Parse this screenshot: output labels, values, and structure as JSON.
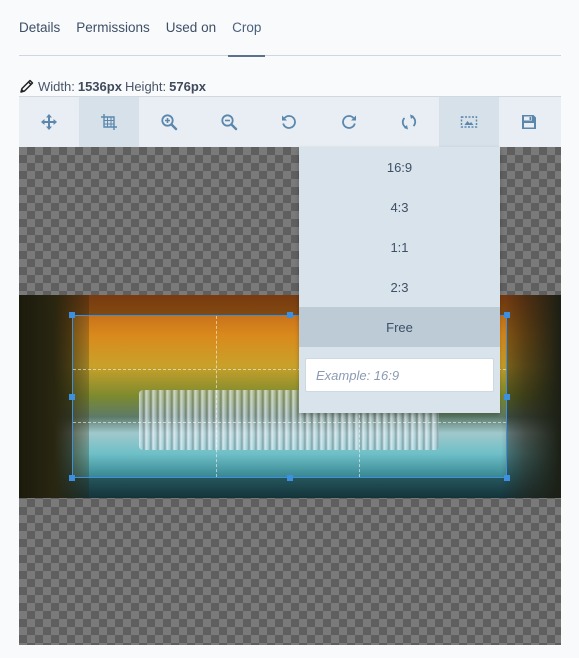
{
  "tabs": [
    {
      "label": "Details",
      "active": false
    },
    {
      "label": "Permissions",
      "active": false
    },
    {
      "label": "Used on",
      "active": false
    },
    {
      "label": "Crop",
      "active": true
    }
  ],
  "dimensions": {
    "width_label": "Width:",
    "width_value": "1536px",
    "height_label": "Height:",
    "height_value": "576px",
    "icon": "pencil-icon"
  },
  "toolbar": {
    "tools": [
      {
        "name": "move",
        "icon": "move-arrows-icon",
        "active": false
      },
      {
        "name": "crop",
        "icon": "crop-icon",
        "active": true
      },
      {
        "name": "zoom-in",
        "icon": "zoom-in-icon",
        "active": false
      },
      {
        "name": "zoom-out",
        "icon": "zoom-out-icon",
        "active": false
      },
      {
        "name": "rotate-left",
        "icon": "rotate-left-icon",
        "active": false
      },
      {
        "name": "rotate-right",
        "icon": "rotate-right-icon",
        "active": false
      },
      {
        "name": "reset",
        "icon": "reset-icon",
        "active": false
      },
      {
        "name": "aspect-ratio",
        "icon": "aspect-ratio-icon",
        "active": true
      },
      {
        "name": "save",
        "icon": "save-icon",
        "active": false
      }
    ]
  },
  "aspect_dropdown": {
    "options": [
      "16:9",
      "4:3",
      "1:1",
      "2:3",
      "Free"
    ],
    "selected": "Free",
    "custom_input": {
      "value": "",
      "placeholder": "Example: 16:9"
    }
  },
  "colors": {
    "accent": "#5a7190",
    "crop_border": "#3d8fe0",
    "toolbar_bg": "#e8eef3",
    "dropdown_bg": "#d8e3eb",
    "selected_bg": "#bccbd5"
  }
}
